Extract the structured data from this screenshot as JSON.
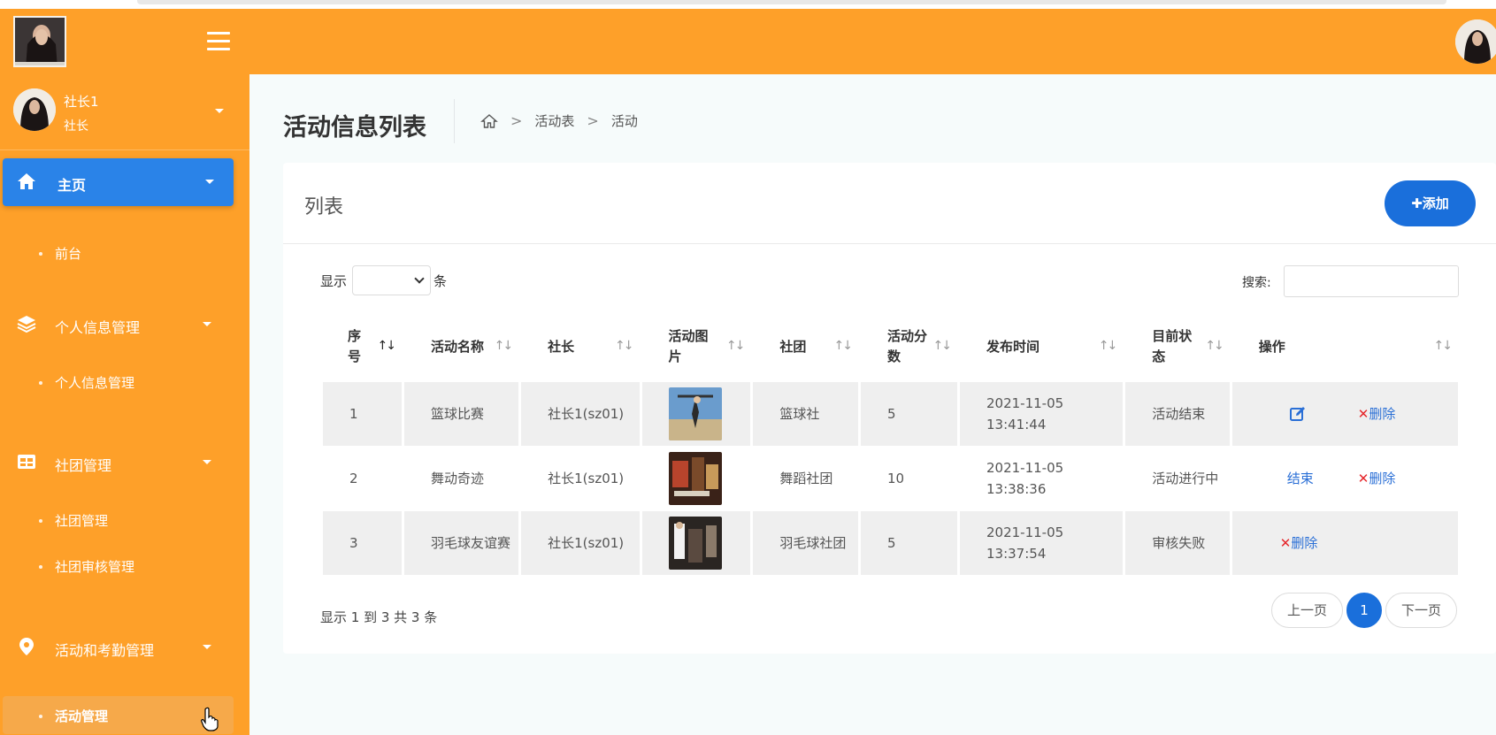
{
  "header": {
    "logo_icon": "user-photo-logo",
    "menu_icon": "hamburger-menu-icon",
    "avatar_icon": "user-avatar-photo"
  },
  "user": {
    "name": "社长1",
    "role": "社长"
  },
  "sidebar": {
    "items": [
      {
        "label": "主页",
        "icon": "home-icon",
        "active": true,
        "children": [
          "前台"
        ]
      },
      {
        "label": "个人信息管理",
        "icon": "layers-icon",
        "children": [
          "个人信息管理"
        ]
      },
      {
        "label": "社团管理",
        "icon": "grid-table-icon",
        "children": [
          "社团管理",
          "社团审核管理"
        ]
      },
      {
        "label": "活动和考勤管理",
        "icon": "map-pin-icon",
        "children": [
          "活动管理"
        ]
      }
    ],
    "accent": "#fea029",
    "active_color": "#2a83e8"
  },
  "page": {
    "title": "活动信息列表",
    "breadcrumb": [
      "活动表",
      "活动"
    ]
  },
  "card": {
    "title": "列表",
    "add_label": "添加",
    "show_label": "显示",
    "show_unit": "条",
    "search_label": "搜索:",
    "search_value": ""
  },
  "table": {
    "headers": [
      {
        "label": "序号",
        "sort": "asc"
      },
      {
        "label": "活动名称",
        "sort": "none"
      },
      {
        "label": "社长",
        "sort": "none"
      },
      {
        "label": "活动图片",
        "sort": "none"
      },
      {
        "label": "社团",
        "sort": "none"
      },
      {
        "label": "活动分数",
        "sort": "none"
      },
      {
        "label": "发布时间",
        "sort": "none"
      },
      {
        "label": "目前状态",
        "sort": "none"
      },
      {
        "label": "操作",
        "sort": "none"
      }
    ],
    "rows": [
      {
        "id": "1",
        "name": "篮球比赛",
        "leader": "社长1(sz01)",
        "club": "篮球社",
        "score": "5",
        "time": "2021-11-05 13:41:44",
        "status": "活动结束",
        "ops": [
          "edit-icon",
          "删除"
        ]
      },
      {
        "id": "2",
        "name": "舞动奇迹",
        "leader": "社长1(sz01)",
        "club": "舞蹈社团",
        "score": "10",
        "time": "2021-11-05 13:38:36",
        "status": "活动进行中",
        "ops": [
          "结束",
          "删除"
        ]
      },
      {
        "id": "3",
        "name": "羽毛球友谊赛",
        "leader": "社长1(sz01)",
        "club": "羽毛球社团",
        "score": "5",
        "time": "2021-11-05 13:37:54",
        "status": "审核失败",
        "ops": [
          "删除"
        ]
      }
    ]
  },
  "footer": {
    "info": "显示 1 到 3 共 3 条",
    "prev": "上一页",
    "current": "1",
    "next": "下一页"
  }
}
